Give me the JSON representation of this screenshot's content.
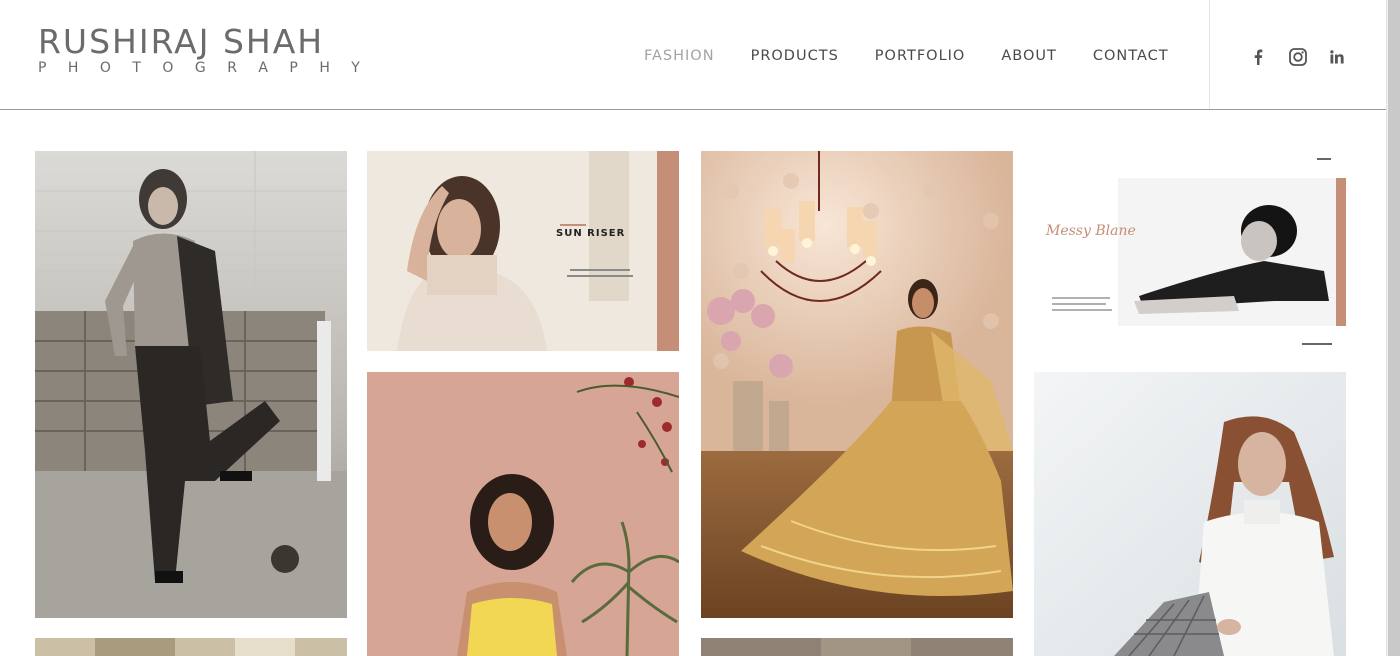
{
  "logo": {
    "name": "RUSHIRAJ SHAH",
    "sub": [
      "P",
      "H",
      "O",
      "T",
      "O",
      "G",
      "R",
      "A",
      "P",
      "H",
      "Y"
    ]
  },
  "nav": {
    "items": [
      {
        "label": "FASHION",
        "active": true
      },
      {
        "label": "PRODUCTS",
        "active": false
      },
      {
        "label": "PORTFOLIO",
        "active": false
      },
      {
        "label": "ABOUT",
        "active": false
      },
      {
        "label": "CONTACT",
        "active": false
      }
    ]
  },
  "social": {
    "icons": [
      "facebook-icon",
      "instagram-icon",
      "linkedin-icon"
    ]
  },
  "gallery": {
    "sun_riser_title": "SUN RISER",
    "messy_blane_title": "Messy Blane"
  },
  "colors": {
    "nav_text": "#4a4a4a",
    "nav_active": "#a3a3a3",
    "logo": "#6b6b6b",
    "accent_copper": "#c48e77"
  }
}
